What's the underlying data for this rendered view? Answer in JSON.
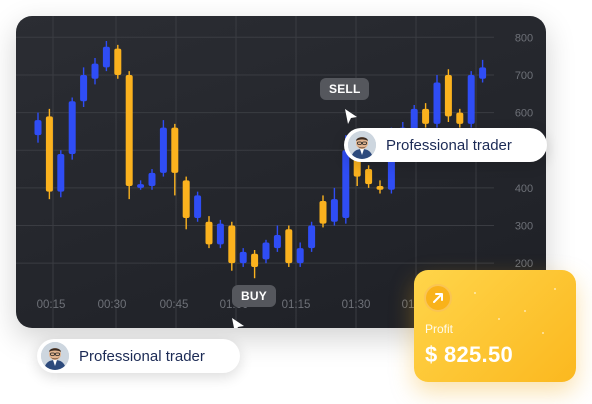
{
  "chart": {
    "y_ticks": [
      "800",
      "700",
      "600",
      "500",
      "400",
      "300",
      "200"
    ],
    "x_ticks": [
      "00:15",
      "00:30",
      "00:45",
      "01:00",
      "01:15",
      "01:30",
      "01:45"
    ],
    "colors": {
      "up": "#2f4df5",
      "down": "#fbb21e",
      "grid": "#3a3c42",
      "text": "#6e7178"
    }
  },
  "chart_data": {
    "type": "candlestick",
    "xlabel": "",
    "ylabel": "",
    "ylim": [
      150,
      830
    ],
    "candles": [
      {
        "dir": "up",
        "open": 540,
        "close": 580,
        "high": 600,
        "low": 520
      },
      {
        "dir": "down",
        "open": 590,
        "close": 390,
        "high": 610,
        "low": 370
      },
      {
        "dir": "up",
        "open": 390,
        "close": 490,
        "high": 500,
        "low": 375
      },
      {
        "dir": "up",
        "open": 490,
        "close": 630,
        "high": 640,
        "low": 475
      },
      {
        "dir": "up",
        "open": 630,
        "close": 700,
        "high": 720,
        "low": 615
      },
      {
        "dir": "up",
        "open": 690,
        "close": 730,
        "high": 745,
        "low": 675
      },
      {
        "dir": "up",
        "open": 720,
        "close": 775,
        "high": 790,
        "low": 710
      },
      {
        "dir": "down",
        "open": 770,
        "close": 700,
        "high": 780,
        "low": 690
      },
      {
        "dir": "down",
        "open": 700,
        "close": 405,
        "high": 710,
        "low": 370
      },
      {
        "dir": "up",
        "open": 400,
        "close": 410,
        "high": 420,
        "low": 395
      },
      {
        "dir": "up",
        "open": 405,
        "close": 440,
        "high": 450,
        "low": 395
      },
      {
        "dir": "up",
        "open": 440,
        "close": 560,
        "high": 580,
        "low": 430
      },
      {
        "dir": "down",
        "open": 560,
        "close": 440,
        "high": 570,
        "low": 380
      },
      {
        "dir": "down",
        "open": 420,
        "close": 320,
        "high": 430,
        "low": 290
      },
      {
        "dir": "up",
        "open": 320,
        "close": 380,
        "high": 390,
        "low": 310
      },
      {
        "dir": "down",
        "open": 310,
        "close": 250,
        "high": 325,
        "low": 240
      },
      {
        "dir": "up",
        "open": 250,
        "close": 305,
        "high": 315,
        "low": 240
      },
      {
        "dir": "down",
        "open": 300,
        "close": 200,
        "high": 310,
        "low": 180
      },
      {
        "dir": "up",
        "open": 200,
        "close": 230,
        "high": 240,
        "low": 190
      },
      {
        "dir": "down",
        "open": 225,
        "close": 190,
        "high": 235,
        "low": 160
      },
      {
        "dir": "up",
        "open": 210,
        "close": 255,
        "high": 262,
        "low": 200
      },
      {
        "dir": "up",
        "open": 240,
        "close": 275,
        "high": 300,
        "low": 230
      },
      {
        "dir": "down",
        "open": 290,
        "close": 200,
        "high": 300,
        "low": 190
      },
      {
        "dir": "up",
        "open": 200,
        "close": 240,
        "high": 255,
        "low": 190
      },
      {
        "dir": "up",
        "open": 240,
        "close": 300,
        "high": 310,
        "low": 230
      },
      {
        "dir": "down",
        "open": 365,
        "close": 305,
        "high": 380,
        "low": 295
      },
      {
        "dir": "up",
        "open": 310,
        "close": 370,
        "high": 400,
        "low": 300
      },
      {
        "dir": "up",
        "open": 320,
        "close": 500,
        "high": 540,
        "low": 305
      },
      {
        "dir": "down",
        "open": 500,
        "close": 430,
        "high": 520,
        "low": 405
      },
      {
        "dir": "down",
        "open": 450,
        "close": 410,
        "high": 460,
        "low": 400
      },
      {
        "dir": "down",
        "open": 405,
        "close": 395,
        "high": 420,
        "low": 385
      },
      {
        "dir": "up",
        "open": 395,
        "close": 540,
        "high": 560,
        "low": 385
      },
      {
        "dir": "up",
        "open": 540,
        "close": 560,
        "high": 575,
        "low": 530
      },
      {
        "dir": "up",
        "open": 555,
        "close": 610,
        "high": 620,
        "low": 540
      },
      {
        "dir": "down",
        "open": 610,
        "close": 570,
        "high": 625,
        "low": 560
      },
      {
        "dir": "up",
        "open": 570,
        "close": 680,
        "high": 700,
        "low": 560
      },
      {
        "dir": "down",
        "open": 700,
        "close": 590,
        "high": 715,
        "low": 575
      },
      {
        "dir": "down",
        "open": 600,
        "close": 570,
        "high": 610,
        "low": 560
      },
      {
        "dir": "up",
        "open": 570,
        "close": 700,
        "high": 710,
        "low": 560
      },
      {
        "dir": "up",
        "open": 690,
        "close": 720,
        "high": 740,
        "low": 680
      }
    ]
  },
  "labels": {
    "sell": "SELL",
    "buy": "BUY"
  },
  "traders": [
    {
      "label": "Professional trader"
    },
    {
      "label": "Professional trader"
    }
  ],
  "profit": {
    "label": "Profit",
    "value": "$ 825.50"
  }
}
